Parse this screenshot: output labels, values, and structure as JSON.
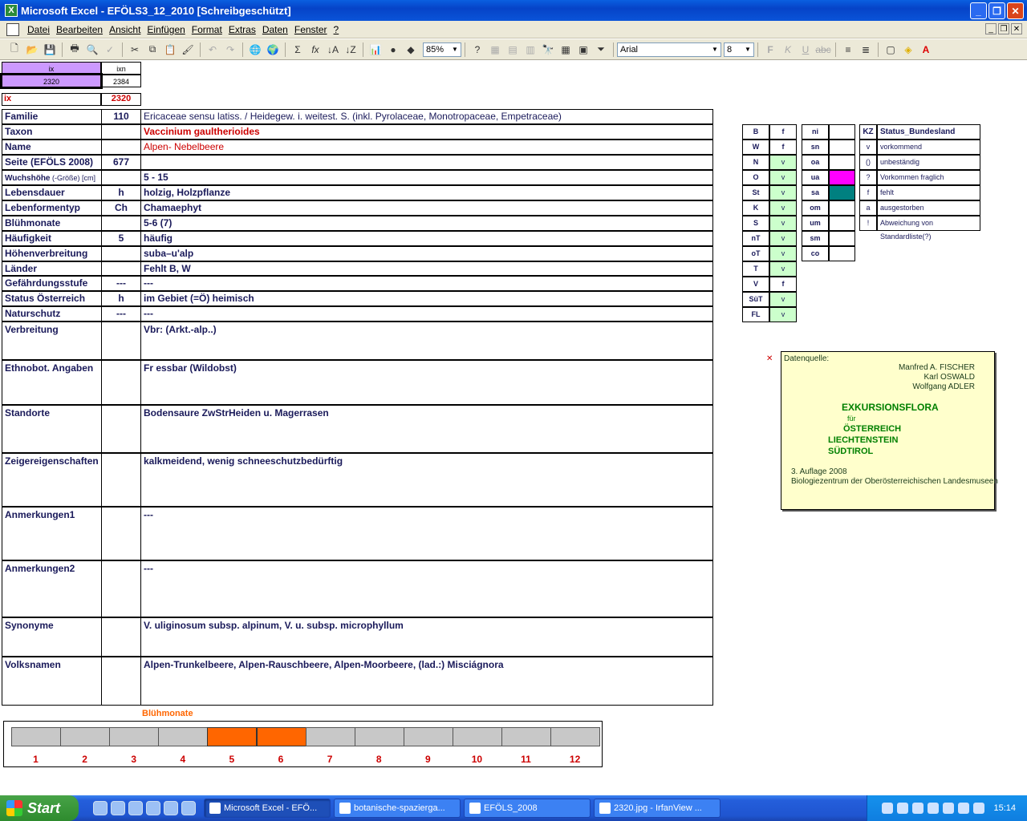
{
  "window": {
    "title": "Microsoft Excel - EFÖLS3_12_2010  [Schreibgeschützt]",
    "app_icon": "excel-icon"
  },
  "menu": [
    "Datei",
    "Bearbeiten",
    "Ansicht",
    "Einfügen",
    "Format",
    "Extras",
    "Daten",
    "Fenster",
    "?"
  ],
  "toolbar": {
    "zoom": "85%",
    "font": "Arial",
    "size": "8"
  },
  "header": {
    "ix_label": "ix",
    "ixn_label": "ixn",
    "ix_value": "2320",
    "ixn_value": "2384",
    "ix_label2": "ix",
    "ix_value2": "2320"
  },
  "rows": [
    {
      "label": "Familie",
      "code": "110",
      "value": "Ericaceae sensu latiss.  /  Heidegew. i. weitest. S. (inkl. Pyrolaceae, Monotropaceae, Empetraceae)"
    },
    {
      "label": "Taxon",
      "code": "",
      "value": "Vaccinium gaultherioides"
    },
    {
      "label": "Name",
      "code": "",
      "value": "Alpen- Nebelbeere"
    },
    {
      "label": "Seite (EFÖLS 2008)",
      "code": "677",
      "value": ""
    },
    {
      "label": "Wuchshöhe",
      "label_small": " (-Größe) [cm]",
      "code": "",
      "value": " 5 - 15"
    },
    {
      "label": "Lebensdauer",
      "code": "h",
      "value": "holzig, Holzpflanze"
    },
    {
      "label": "Lebenformentyp",
      "code": "Ch",
      "value": "Chamaephyt"
    },
    {
      "label": "Blühmonate",
      "code": "",
      "value": " 5-6 (7)"
    },
    {
      "label": "Häufigkeit",
      "code": "5",
      "value": "häufig"
    },
    {
      "label": "Höhenverbreitung",
      "code": "",
      "value": "suba–u'alp"
    },
    {
      "label": "Länder",
      "code": "",
      "value": " Fehlt B, W"
    },
    {
      "label": "Gefährdungsstufe",
      "code": "---",
      "value": "   ---"
    },
    {
      "label": "Status Österreich",
      "code": "h",
      "value": "im Gebiet (=Ö) heimisch"
    },
    {
      "label": "Naturschutz",
      "code": "---",
      "value": "---"
    },
    {
      "label": "Verbreitung",
      "code": "",
      "value": "Vbr: (Arkt.-alp..)"
    },
    {
      "label": "Ethnobot. Angaben",
      "code": "",
      "value": "Fr essbar (Wildobst)"
    },
    {
      "label": "Standorte",
      "code": "",
      "value": "Bodensaure ZwStrHeiden u. Magerrasen"
    },
    {
      "label": "Zeigereigenschaften",
      "code": "",
      "value": " kalkmeidend, wenig schneeschutzbedürftig"
    },
    {
      "label": "Anmerkungen1",
      "code": "",
      "value": "---"
    },
    {
      "label": "Anmerkungen2",
      "code": "",
      "value": "---"
    },
    {
      "label": "Synonyme",
      "code": "",
      "value": "V. uliginosum subsp. alpinum, V. u. subsp. microphyllum"
    },
    {
      "label": "Volksnamen",
      "code": "",
      "value": "Alpen-Trunkelbeere,   Alpen-Rauschbeere, Alpen-Moorbeere, (lad.:) Misciágnora"
    }
  ],
  "states": [
    {
      "k": "B",
      "v": "f"
    },
    {
      "k": "W",
      "v": "f"
    },
    {
      "k": "N",
      "v": "v"
    },
    {
      "k": "O",
      "v": "v"
    },
    {
      "k": "St",
      "v": "v"
    },
    {
      "k": "K",
      "v": "v"
    },
    {
      "k": "S",
      "v": "v"
    },
    {
      "k": "nT",
      "v": "v"
    },
    {
      "k": "oT",
      "v": "v"
    },
    {
      "k": "T",
      "v": "v"
    },
    {
      "k": "V",
      "v": "f"
    },
    {
      "k": "SüT",
      "v": "v"
    },
    {
      "k": "FL",
      "v": "v"
    }
  ],
  "regions": [
    {
      "k": "ni",
      "v": ""
    },
    {
      "k": "sn",
      "v": ""
    },
    {
      "k": "oa",
      "v": ""
    },
    {
      "k": "ua",
      "v": "",
      "color": "#ff00ff"
    },
    {
      "k": "sa",
      "v": "",
      "color": "#008080"
    },
    {
      "k": "om",
      "v": ""
    },
    {
      "k": "um",
      "v": ""
    },
    {
      "k": "sm",
      "v": ""
    },
    {
      "k": "co",
      "v": ""
    }
  ],
  "legend": {
    "head_k": "KZ",
    "head_v": "Status_Bundesland",
    "items": [
      {
        "k": "v",
        "v": "vorkommend"
      },
      {
        "k": "()",
        "v": "unbeständig"
      },
      {
        "k": "?",
        "v": "Vorkommen fraglich"
      },
      {
        "k": "f",
        "v": "fehlt"
      },
      {
        "k": "a",
        "v": "ausgestorben"
      },
      {
        "k": "!",
        "v": "Abweichung von Standardliste(?)"
      }
    ]
  },
  "infobox": {
    "source": "Datenquelle:",
    "a1": "Manfred A. FISCHER",
    "a2": "Karl OSWALD",
    "a3": "Wolfgang ADLER",
    "t1": "EXKURSIONSFLORA",
    "t2": "für",
    "t3": "ÖSTERREICH",
    "t4": "LIECHTENSTEIN",
    "t5": "SÜDTIROL",
    "e1": "3. Auflage 2008",
    "e2": "Biologiezentrum der Oberösterreichischen Landesmuseen"
  },
  "bloom": {
    "title": "Blühmonate",
    "months": [
      "1",
      "2",
      "3",
      "4",
      "5",
      "6",
      "7",
      "8",
      "9",
      "10",
      "11",
      "12"
    ],
    "active": [
      5,
      6
    ],
    "active_color": "#ff6600"
  },
  "taskbar": {
    "start": "Start",
    "tasks": [
      "Microsoft Excel - EFÖ...",
      "botanische-spazierga...",
      "EFÖLS_2008",
      "2320.jpg - IrfanView ..."
    ],
    "clock": "15:14"
  }
}
